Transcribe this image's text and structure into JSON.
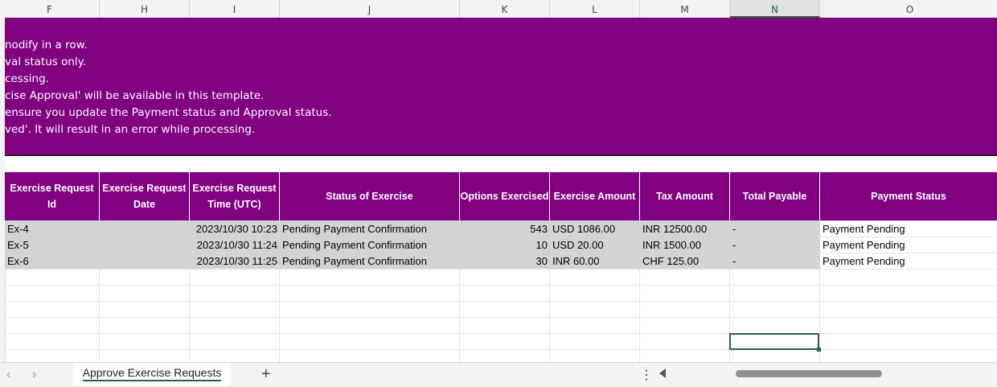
{
  "columns": [
    "F",
    "H",
    "I",
    "J",
    "K",
    "L",
    "M",
    "N",
    "O"
  ],
  "selected_column": "N",
  "notes": [
    "nodify in a row.",
    "val status only.",
    "cessing.",
    "cise Approval' will be available in this template.",
    " ensure you update the Payment status and Approval status.",
    "ved'. It will result in an error while processing."
  ],
  "headers": {
    "id": "Exercise Request Id",
    "date": "Exercise Request Date",
    "time": "Exercise Request Time (UTC)",
    "status": "Status of Exercise",
    "options": "Options Exercised",
    "amount": "Exercise Amount",
    "tax": "Tax Amount",
    "total": "Total Payable",
    "payment": "Payment Status"
  },
  "rows": [
    {
      "id": "Ex-4",
      "datetime": "2023/10/30 10:23",
      "status": "Pending Payment Confirmation",
      "options": "543",
      "amount": "USD 1086.00",
      "tax": "INR 12500.00",
      "total": "-",
      "payment": "Payment Pending"
    },
    {
      "id": "Ex-5",
      "datetime": "2023/10/30 11:24",
      "status": "Pending Payment Confirmation",
      "options": "10",
      "amount": "USD 20.00",
      "tax": "INR 1500.00",
      "total": "-",
      "payment": "Payment Pending"
    },
    {
      "id": "Ex-6",
      "datetime": "2023/10/30 11:25",
      "status": "Pending Payment Confirmation",
      "options": "30",
      "amount": "INR 60.00",
      "tax": "CHF 125.00",
      "total": "-",
      "payment": "Payment Pending"
    }
  ],
  "sheet_tab": "Approve Exercise Requests",
  "add_sheet": "+",
  "more": "⋮",
  "nav_prev": "‹",
  "nav_next": "›"
}
